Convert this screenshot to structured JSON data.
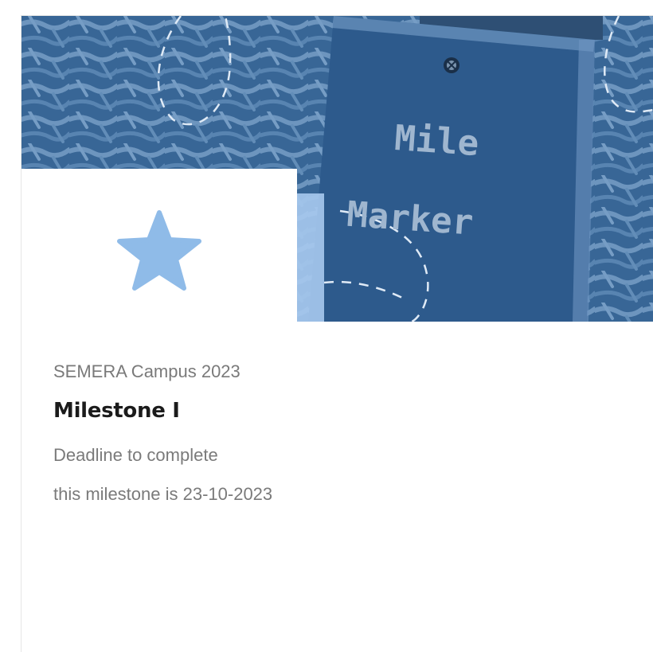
{
  "banner": {
    "sign_text_line1": "Mile",
    "sign_text_line2": "Marker",
    "accent_color": "#a7c9ee",
    "overlay_color": "#3c6da3"
  },
  "card": {
    "icon": "star-icon",
    "subtitle": "SEMERA Campus 2023",
    "title": "Milestone I",
    "description_line1": "Deadline to complete",
    "description_line2": "this milestone is 23-10-2023"
  }
}
